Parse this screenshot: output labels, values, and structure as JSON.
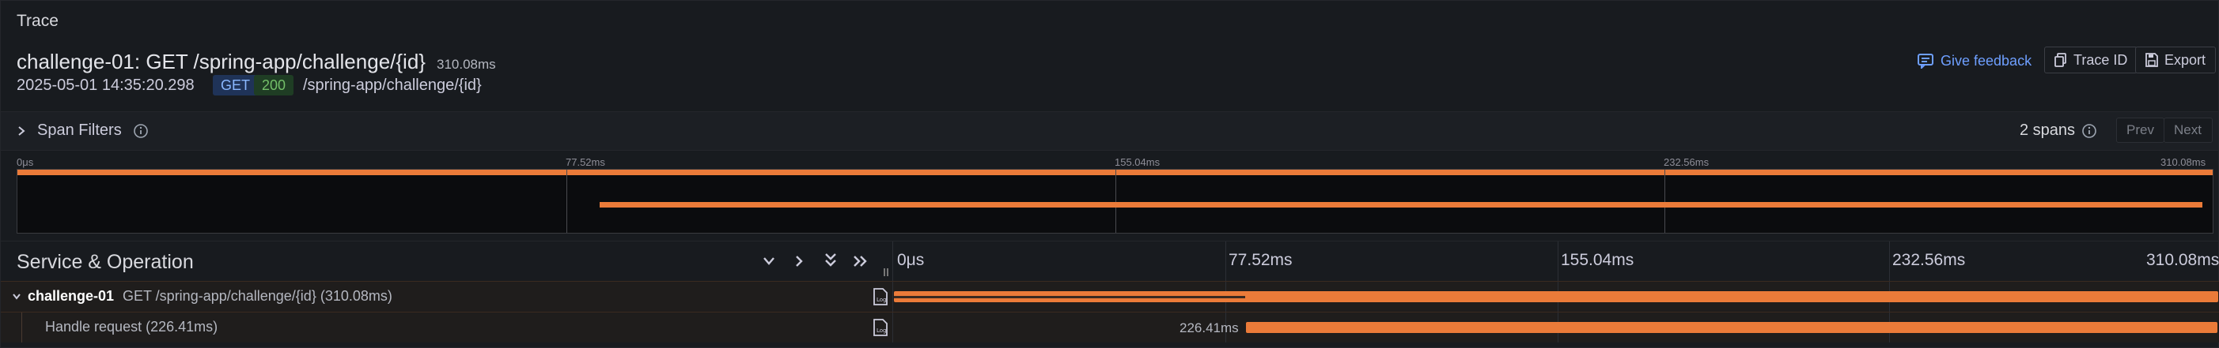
{
  "panel": {
    "title": "Trace"
  },
  "trace": {
    "name": "challenge-01: GET /spring-app/challenge/{id}",
    "duration": "310.08ms",
    "timestamp": "2025-05-01 14:35:20.298",
    "method": "GET",
    "status": "200",
    "url": "/spring-app/challenge/{id}"
  },
  "actions": {
    "feedback": "Give feedback",
    "trace_id": "Trace ID",
    "export": "Export"
  },
  "filters": {
    "label": "Span Filters",
    "span_count": "2 spans",
    "prev": "Prev",
    "next": "Next"
  },
  "minimap": {
    "ticks": [
      "0μs",
      "77.52ms",
      "155.04ms",
      "232.56ms",
      "310.08ms"
    ]
  },
  "timeline": {
    "header": "Service & Operation",
    "ticks": [
      "0μs",
      "77.52ms",
      "155.04ms",
      "232.56ms",
      "310.08ms"
    ]
  },
  "spans": [
    {
      "service": "challenge-01",
      "operation": "GET /spring-app/challenge/{id} (310.08ms)",
      "start_ms": 0,
      "duration_ms": 310.08,
      "self_start_ms": 74.0
    },
    {
      "service": "",
      "operation": "Handle request (226.41ms)",
      "bar_label": "226.41ms",
      "start_ms": 74.0,
      "duration_ms": 226.41
    }
  ],
  "colors": {
    "accent": "#eb7b39",
    "link": "#6e9fff",
    "get_badge_bg": "#1f3358",
    "ok_badge_bg": "#1f3d24"
  }
}
